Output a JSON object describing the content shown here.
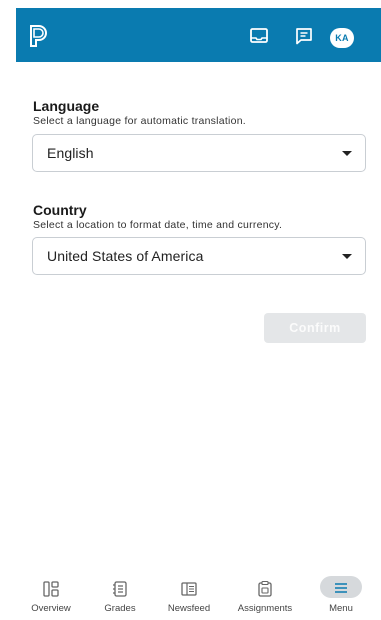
{
  "header": {
    "logo_icon": "powerschool-p-logo",
    "inbox_icon": "inbox-tray-icon",
    "messages_icon": "message-icon",
    "avatar_initials": "KA",
    "bar_color": "#0a7bb0"
  },
  "language": {
    "title": "Language",
    "subtitle": "Select a language for automatic translation.",
    "selected": "English"
  },
  "country": {
    "title": "Country",
    "subtitle": "Select a location to format date, time and currency.",
    "selected": "United States of America"
  },
  "confirm_label": "Confirm",
  "bottom_nav": {
    "items": [
      {
        "label": "Overview",
        "icon": "overview-icon"
      },
      {
        "label": "Grades",
        "icon": "grades-icon"
      },
      {
        "label": "Newsfeed",
        "icon": "newsfeed-icon"
      },
      {
        "label": "Assignments",
        "icon": "assignments-icon"
      },
      {
        "label": "Menu",
        "icon": "menu-icon",
        "active": true
      }
    ]
  }
}
